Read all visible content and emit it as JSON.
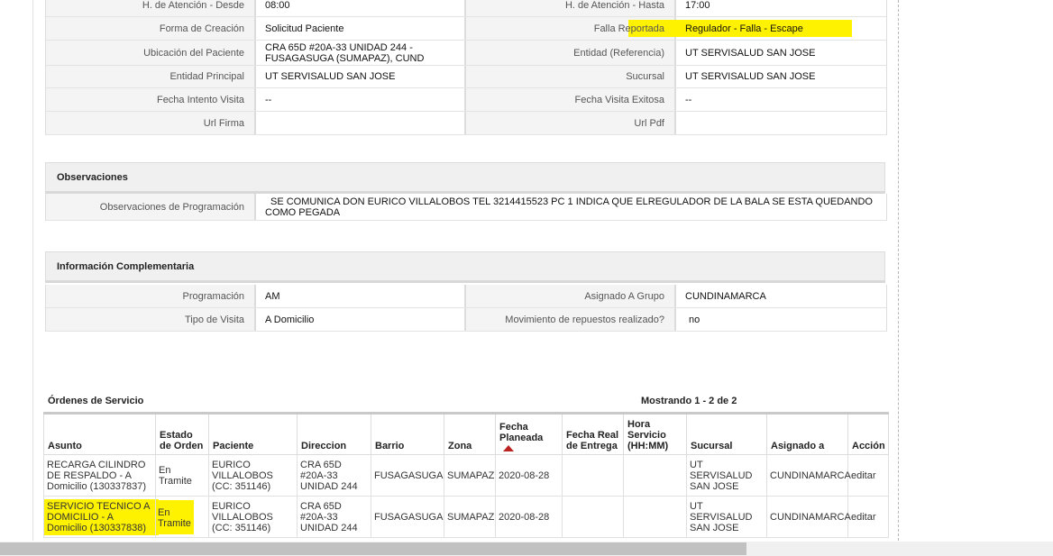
{
  "top_grid": [
    {
      "l1": "H. de Atención - Desde",
      "v1": "08:00",
      "l2": "H. de Atención - Hasta",
      "v2": "17:00"
    },
    {
      "l1": "Forma de Creación",
      "v1": "Solicitud Paciente",
      "l2": "Falla Reportada",
      "v2": "Regulador - Falla - Escape"
    },
    {
      "l1": "Ubicación del Paciente",
      "v1": "CRA 65D #20A-33 UNIDAD 244 - FUSAGASUGA (SUMAPAZ), CUND",
      "l2": "Entidad (Referencia)",
      "v2": "UT SERVISALUD SAN JOSE"
    },
    {
      "l1": "Entidad Principal",
      "v1": "UT SERVISALUD SAN JOSE",
      "l2": "Sucursal",
      "v2": "UT SERVISALUD SAN JOSE"
    },
    {
      "l1": "Fecha Intento Visita",
      "v1": "--",
      "l2": "Fecha Visita Exitosa",
      "v2": "--"
    },
    {
      "l1": "Url Firma",
      "v1": "",
      "l2": "Url Pdf",
      "v2": ""
    }
  ],
  "observaciones": {
    "title": "Observaciones",
    "label": "Observaciones de Programación",
    "value": "SE COMUNICA DON EURICO VILLALOBOS TEL 3214415523 PC 1 INDICA QUE ELREGULADOR DE LA BALA SE ESTA QUEDANDO COMO PEGADA"
  },
  "info_complementaria": {
    "title": "Información Complementaria",
    "rows": [
      {
        "l1": "Programación",
        "v1": "AM",
        "l2": "Asignado A Grupo",
        "v2": "CUNDINAMARCA"
      },
      {
        "l1": "Tipo de Visita",
        "v1": "A Domicilio",
        "l2": "Movimiento de repuestos realizado?",
        "v2": "no"
      }
    ]
  },
  "orders": {
    "title": "Órdenes de Servicio",
    "count": "Mostrando 1 - 2 de 2",
    "headers": [
      "Asunto",
      "Estado de Orden",
      "Paciente",
      "Direccion",
      "Barrio",
      "Zona",
      "Fecha Planeada",
      "Fecha Real de Entrega",
      "Hora Servicio (HH:MM)",
      "Sucursal",
      "Asignado a",
      "Acción"
    ],
    "rows": [
      {
        "asunto": "RECARGA CILINDRO DE RESPALDO - A Domicilio (130337837)",
        "estado": "En Tramite",
        "paciente": "EURICO VILLALOBOS (CC: 351146)",
        "direccion": "CRA 65D #20A-33 UNIDAD 244",
        "barrio": "FUSAGASUGA",
        "zona": "SUMAPAZ",
        "fecha_planeada": "2020-08-28",
        "fecha_real": "",
        "hora": "",
        "sucursal": "UT SERVISALUD SAN JOSE",
        "asignado": "CUNDINAMARCA",
        "accion": "editar"
      },
      {
        "asunto": "SERVICIO TECNICO A DOMICILIO - A Domicilio (130337838)",
        "estado": "En Tramite",
        "paciente": "EURICO VILLALOBOS (CC: 351146)",
        "direccion": "CRA 65D #20A-33 UNIDAD 244",
        "barrio": "FUSAGASUGA",
        "zona": "SUMAPAZ",
        "fecha_planeada": "2020-08-28",
        "fecha_real": "",
        "hora": "",
        "sucursal": "UT SERVISALUD SAN JOSE",
        "asignado": "CUNDINAMARCA",
        "accion": "editar"
      }
    ]
  },
  "colors": {
    "highlight": "#fff200",
    "sort_arrow": "#bb2222"
  }
}
